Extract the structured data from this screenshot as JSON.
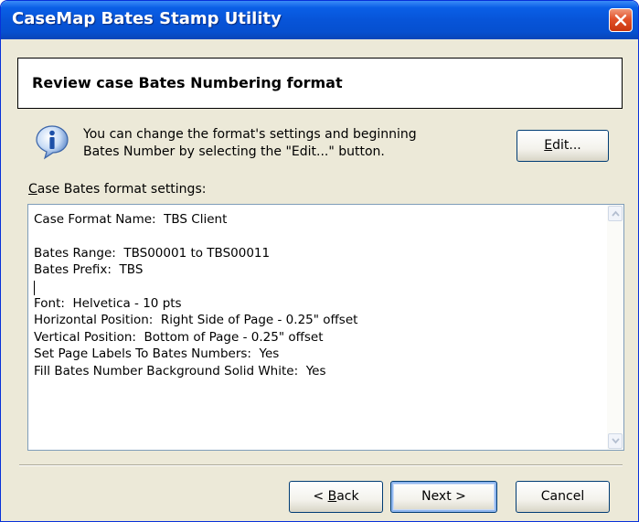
{
  "window": {
    "title": "CaseMap Bates Stamp Utility",
    "close_icon": "close-icon"
  },
  "header": {
    "title": "Review case Bates Numbering format"
  },
  "info": {
    "icon": "info-icon",
    "line1": "You can change the format's settings and beginning",
    "line2": "Bates Number by selecting the \"Edit...\" button."
  },
  "buttons": {
    "edit_prefix": "E",
    "edit_rest": "dit...",
    "back_prefix": "< ",
    "back_accel": "B",
    "back_rest": "ack",
    "next": "Next >",
    "cancel": "Cancel"
  },
  "settings": {
    "label_accel": "C",
    "label_rest": "ase Bates format settings:",
    "lines": [
      "Case Format Name:  TBS Client",
      "",
      "Bates Range:  TBS00001 to TBS00011",
      "Bates Prefix:  TBS",
      "",
      "Font:  Helvetica - 10 pts",
      "Horizontal Position:  Right Side of Page - 0.25\" offset",
      "Vertical Position:  Bottom of Page - 0.25\" offset",
      "Set Page Labels To Bates Numbers:  Yes",
      "Fill Bates Number Background Solid White:  Yes"
    ]
  },
  "colors": {
    "titlebar": "#0754d8",
    "dialog_bg": "#ece9d8",
    "close_button": "#e2512a"
  }
}
